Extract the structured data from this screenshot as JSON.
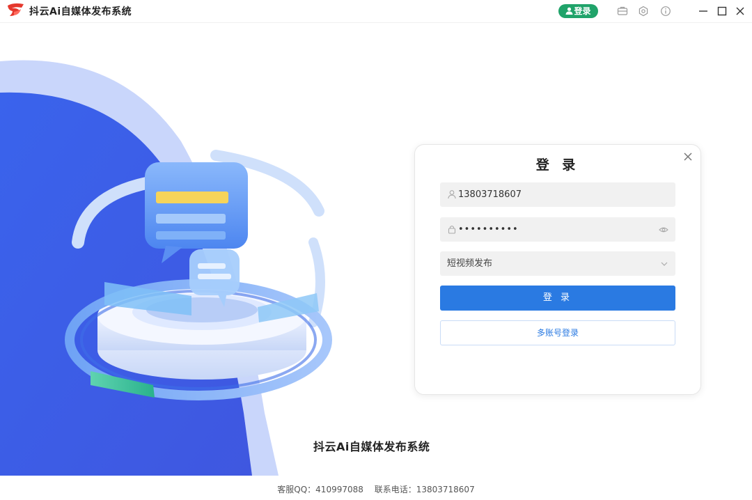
{
  "app": {
    "title": "抖云Ai自媒体发布系统",
    "logo_icon": "brand-logo-icon"
  },
  "titlebar": {
    "login_label": "登录",
    "icons": [
      "briefcase-icon",
      "settings-gear-icon",
      "info-icon"
    ],
    "window_controls": [
      "minimize-icon",
      "maximize-icon",
      "close-icon"
    ]
  },
  "login_card": {
    "title": "登 录",
    "username": {
      "value": "13803718607",
      "icon": "user-icon"
    },
    "password": {
      "value": "••••••••••",
      "icon": "lock-icon",
      "toggle_icon": "eye-icon"
    },
    "mode_select": {
      "value": "短视频发布",
      "icon": "chevron-down-icon"
    },
    "submit_label": "登 录",
    "multi_account_label": "多账号登录",
    "close_icon": "close-icon"
  },
  "hero": {
    "system_name": "抖云Ai自媒体发布系统"
  },
  "footer": {
    "qq": "客服QQ：410997088",
    "phone": "联系电话：13803718607"
  },
  "colors": {
    "accent": "#2a7ae2",
    "login_pill": "#20a36a",
    "hero_blue": "#3c64e8",
    "hero_light": "#c9d6fb"
  }
}
